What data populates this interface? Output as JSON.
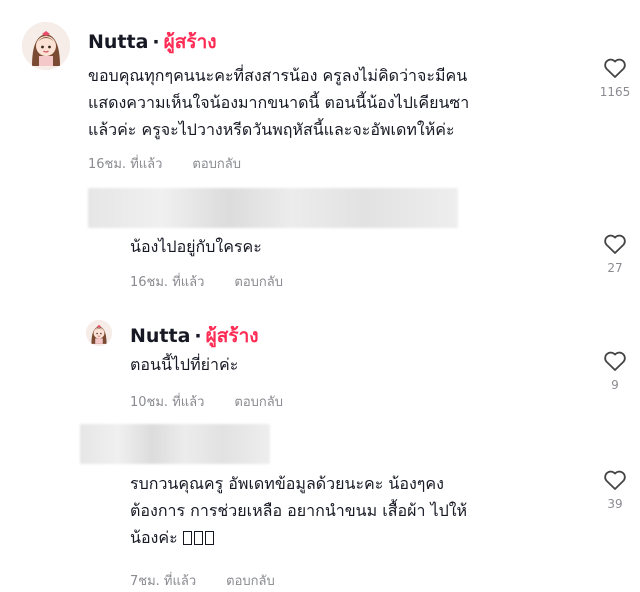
{
  "comments": [
    {
      "author": "Nutta",
      "dot": "·",
      "creator_badge": "ผู้สร้าง",
      "lines": [
        "ขอบคุณทุกๆคนนะคะที่สงสารน้อง ครูลงไม่คิดว่าจะมีคน",
        "แสดงความเห็นใจน้องมากขนาดนี้ ตอนนี้น้องไปเคียนซา",
        "แล้วค่ะ ครูจะไปวางหรีดวันพฤหัสนี้และจะอัพเดทให้ค่ะ"
      ],
      "time": "16ชม. ที่แล้ว",
      "reply_label": "ตอบกลับ",
      "likes": "1165"
    },
    {
      "lines": [
        "น้องไปอยู่กับใครคะ"
      ],
      "time": "16ชม. ที่แล้ว",
      "reply_label": "ตอบกลับ",
      "likes": "27"
    },
    {
      "author": "Nutta",
      "dot": "·",
      "creator_badge": "ผู้สร้าง",
      "lines": [
        "ตอนนี้ไปที่ย่าค่ะ"
      ],
      "time": "10ชม. ที่แล้ว",
      "reply_label": "ตอบกลับ",
      "likes": "9"
    },
    {
      "lines": [
        "รบกวนคุณครู อัพเดทข้อมูลด้วยนะคะ น้องๆคง",
        "ต้องการ การช่วยเหลือ อยากนำขนม เสื้อผ้า ไปให้",
        "น้องค่ะ"
      ],
      "time": "7ชม. ที่แล้ว",
      "reply_label": "ตอบกลับ",
      "likes": "39"
    }
  ],
  "icons": {
    "like": "heart-outline-icon"
  },
  "colors": {
    "creator": "#fe2c55",
    "meta": "#8a8b91",
    "text": "#161823"
  }
}
